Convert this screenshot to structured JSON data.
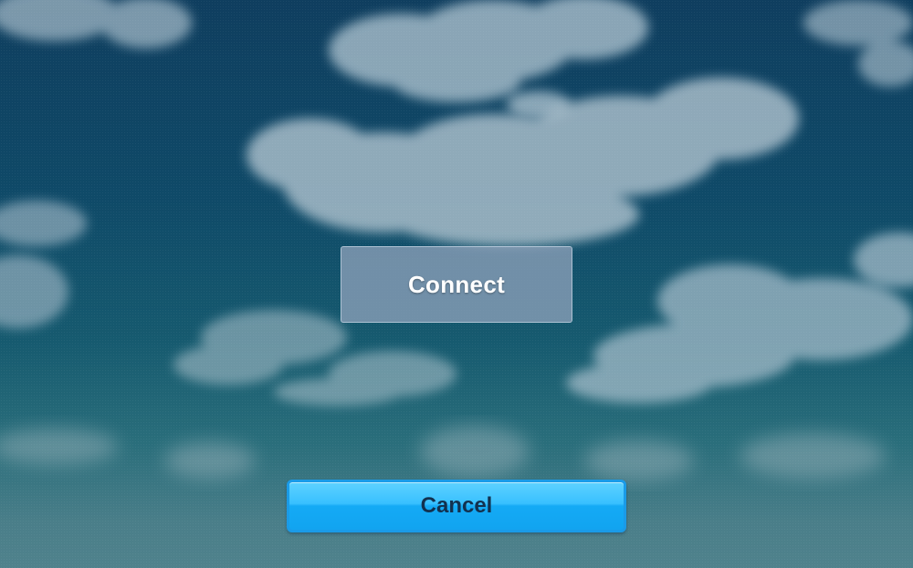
{
  "buttons": {
    "connect_label": "Connect",
    "cancel_label": "Cancel"
  },
  "colors": {
    "sky_top": "#0f3e5f",
    "sky_bottom": "#4f828c",
    "cloud": "#c8d6df",
    "connect_bg": "#8ca0b9",
    "cancel_bg": "#22b4fa",
    "cancel_text": "#12314f"
  }
}
